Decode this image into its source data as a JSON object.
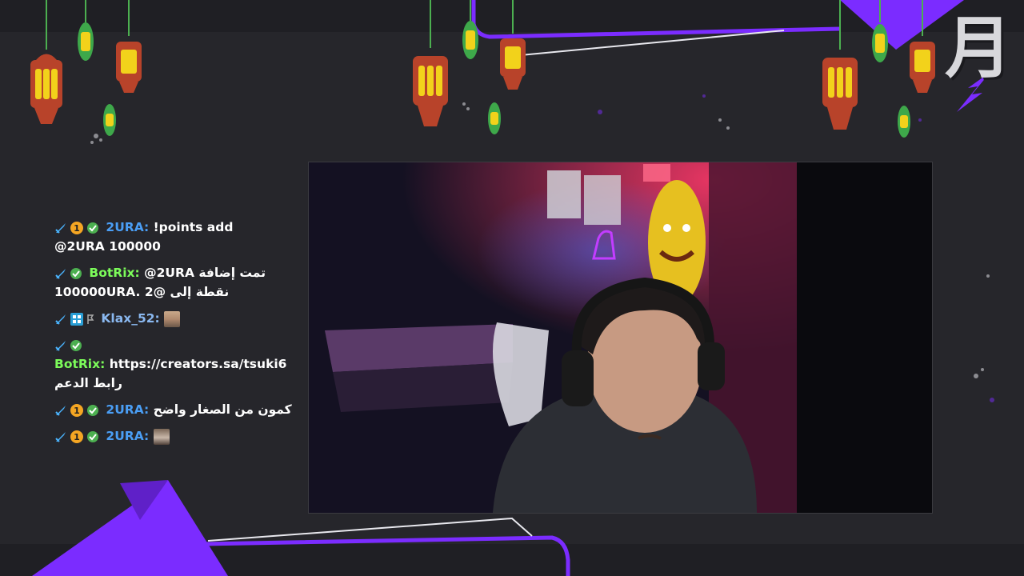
{
  "brand": {
    "logo_glyph": "月",
    "accent": "#7b2cff"
  },
  "chat": {
    "messages": [
      {
        "badges": [
          "sword-icon",
          "rank-1-badge",
          "verified-icon"
        ],
        "user": "2URA:",
        "user_color": "#4a9ef5",
        "text": "!points add",
        "text2": "@2URA 100000"
      },
      {
        "badges": [
          "sword-icon",
          "verified-icon"
        ],
        "user": "BotRix:",
        "user_color": "#7cfc5a",
        "text": "@2URA تمت إضافة",
        "text2": "100000URA. نقطة إلى @2"
      },
      {
        "badges": [
          "sword-icon",
          "kick-badge-icon",
          "flag-icon"
        ],
        "user": "Klax_52:",
        "user_color": "#8ab8f0",
        "emote": "face-emote"
      },
      {
        "badges": [
          "sword-icon",
          "verified-icon"
        ],
        "user": "BotRix:",
        "user_color": "#7cfc5a",
        "text": "https://creators.sa/tsuki6",
        "text2": "رابط الدعم"
      },
      {
        "badges": [
          "sword-icon",
          "rank-1-badge",
          "verified-icon"
        ],
        "user": "2URA:",
        "user_color": "#4a9ef5",
        "text": "كمون من الصغار واضح"
      },
      {
        "badges": [
          "sword-icon",
          "rank-1-badge",
          "verified-icon"
        ],
        "user": "2URA:",
        "user_color": "#4a9ef5",
        "emote": "man-emote"
      }
    ]
  },
  "camera": {
    "label": "webcam-feed"
  },
  "decor": {
    "lantern_color_red": "#b8432a",
    "lantern_color_green": "#4caf50",
    "window_yellow": "#f2d21b"
  }
}
